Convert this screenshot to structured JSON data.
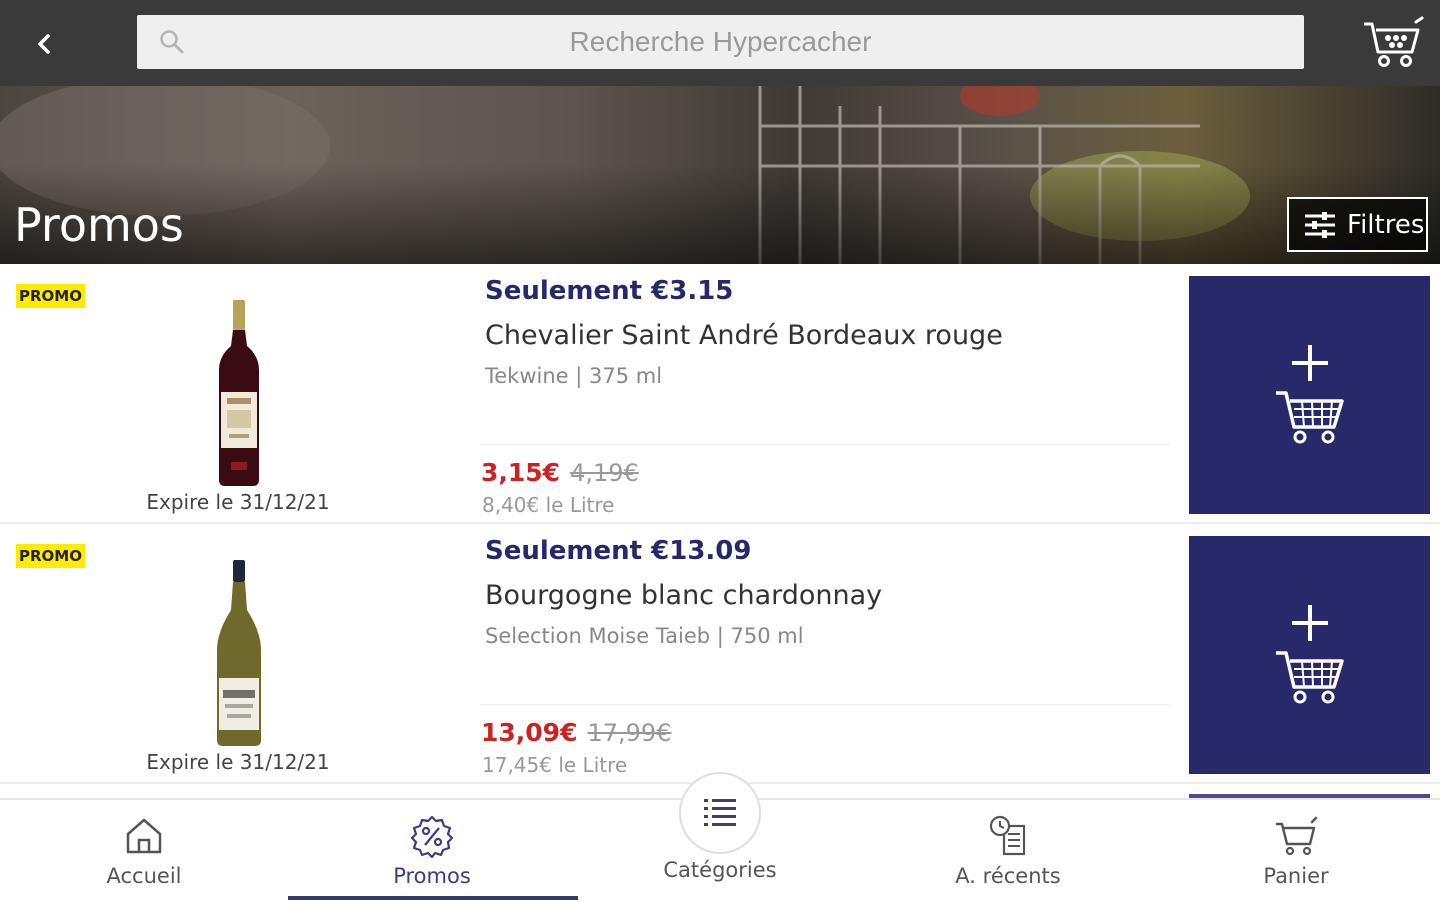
{
  "search": {
    "placeholder": "Recherche Hypercacher"
  },
  "icons": {
    "back": "chevron-left-icon",
    "search": "search-icon",
    "cart": "cart-icon",
    "filters": "sliders-icon",
    "add_to_cart": "add-to-cart-icon"
  },
  "colors": {
    "topbar": "#3a3a3a",
    "accent": "#28296b",
    "promo_badge": "#ffeb00",
    "price": "#cc2222",
    "headline": "#25286a"
  },
  "banner": {
    "title": "Promos",
    "filters_label": "Filtres"
  },
  "products": [
    {
      "badge": "PROMO",
      "expiry": "Expire le 31/12/21",
      "headline": "Seulement €3.15",
      "name": "Chevalier Saint André Bordeaux rouge",
      "meta": "Tekwine | 375 ml",
      "price": "3,15€",
      "old_price": "4,19€",
      "unit_price": "8,40€ le Litre",
      "wine_color": "red"
    },
    {
      "badge": "PROMO",
      "expiry": "Expire le 31/12/21",
      "headline": "Seulement €13.09",
      "name": "Bourgogne blanc chardonnay",
      "meta": "Selection Moise Taieb | 750 ml",
      "price": "13,09€",
      "old_price": "17,99€",
      "unit_price": "17,45€ le Litre",
      "wine_color": "white"
    }
  ],
  "nav": {
    "items": [
      {
        "label": "Accueil",
        "icon": "home-icon"
      },
      {
        "label": "Promos",
        "icon": "percent-icon",
        "active": true
      },
      {
        "label": "Catégories",
        "icon": "list-icon"
      },
      {
        "label": "A. récents",
        "icon": "recent-icon"
      },
      {
        "label": "Panier",
        "icon": "cart-icon"
      }
    ]
  }
}
